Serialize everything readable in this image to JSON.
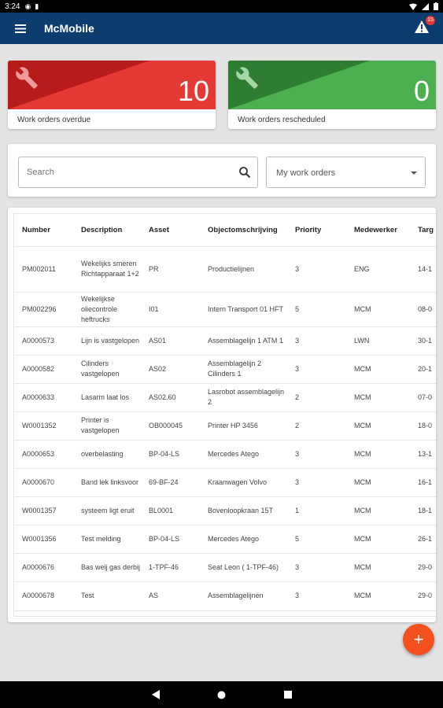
{
  "status_bar": {
    "time": "3:24"
  },
  "app_bar": {
    "title": "McMobile",
    "alert_count": "15"
  },
  "summary": {
    "overdue": {
      "count": "10",
      "label": "Work orders overdue",
      "color_dark": "#b71c1c",
      "color_light": "#e53935"
    },
    "rescheduled": {
      "count": "0",
      "label": "Work orders rescheduled",
      "color_dark": "#2e7d32",
      "color_light": "#4caf50"
    }
  },
  "filters": {
    "search_placeholder": "Search",
    "scope_selected": "My work orders"
  },
  "table": {
    "columns": [
      "Number",
      "Description",
      "Asset",
      "Objectomschrijving",
      "Priority",
      "Medewerker",
      "Targ"
    ],
    "rows": [
      [
        "PM002011",
        "Wekelijks smeren Richtapparaat 1+2",
        "PR",
        "Productielijnen",
        "3",
        "ENG",
        "14-1"
      ],
      [
        "PM002296",
        "Wekelijkse oliecontrole heftrucks",
        "I01",
        "Intern Transport 01 HFT",
        "5",
        "MCM",
        "08-0"
      ],
      [
        "A0000573",
        "Lijn is vastgelopen",
        "AS01",
        "Assemblagelijn 1 ATM 1",
        "3",
        "LWN",
        "30-1"
      ],
      [
        "A0000582",
        "Cilinders vastgelopen",
        "AS02",
        "Assemblagelijn 2 Cilinders 1",
        "3",
        "MCM",
        "20-1"
      ],
      [
        "A0000633",
        "Lasarm laat los",
        "AS02.60",
        "Lasrobot assemblagelijn 2",
        "2",
        "MCM",
        "07-0"
      ],
      [
        "W0001352",
        "Printer is vastgelopen",
        "OB000045",
        "Printer HP 3456",
        "2",
        "MCM",
        "18-0"
      ],
      [
        "A0000653",
        "overbelasting",
        "BP-04-LS",
        "Mercedes Atego",
        "3",
        "MCM",
        "13-1"
      ],
      [
        "A0000670",
        "Band lek linksvoor",
        "69-BF-24",
        "Kraanwagen Volvo",
        "3",
        "MCM",
        "16-1"
      ],
      [
        "W0001357",
        "systeem ligt eruit",
        "BL0001",
        "Bovenloopkraan 15T",
        "1",
        "MCM",
        "18-1"
      ],
      [
        "W0001356",
        "Test melding",
        "BP-04-LS",
        "Mercedes Atego",
        "5",
        "MCM",
        "26-1"
      ],
      [
        "A0000676",
        "Bas weij gas derbij",
        "1-TPF-46",
        "Seat Leon ( 1-TPF-46)",
        "3",
        "MCM",
        "29-0"
      ],
      [
        "A0000678",
        "Test",
        "AS",
        "Assemblagelijnen",
        "3",
        "MCM",
        "29-0"
      ]
    ]
  },
  "fab": {
    "label": "+"
  },
  "icons": [
    "menu-icon",
    "warning-icon",
    "wrench-icon",
    "search-icon",
    "dropdown-caret-icon",
    "add-icon",
    "back-icon",
    "home-icon",
    "recents-icon"
  ]
}
